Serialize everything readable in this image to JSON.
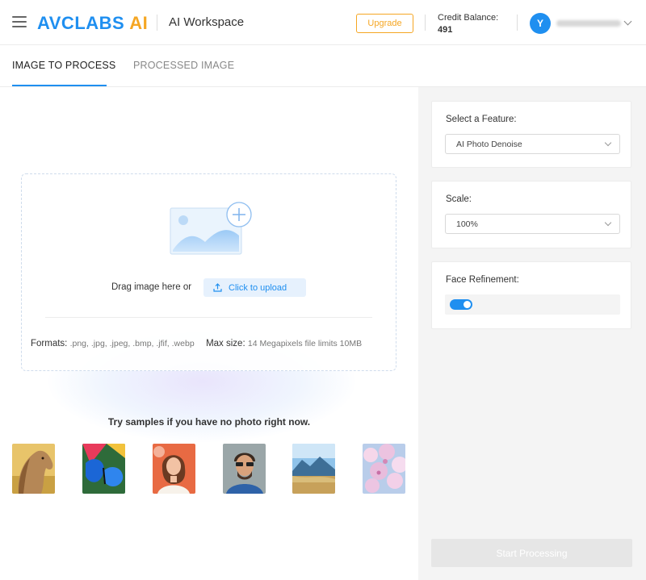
{
  "header": {
    "logo_brand": "AVCLABS",
    "logo_ai": "AI",
    "workspace_title": "AI Workspace",
    "upgrade_label": "Upgrade",
    "credit_label": "Credit Balance:",
    "credit_value": "491",
    "avatar_initial": "Y"
  },
  "tabs": [
    {
      "label": "IMAGE TO PROCESS",
      "active": true
    },
    {
      "label": "PROCESSED IMAGE",
      "active": false
    }
  ],
  "upload": {
    "drag_text": "Drag image here or",
    "button_label": "Click to upload",
    "formats_label": "Formats:",
    "formats_value": ".png, .jpg, .jpeg, .bmp, .jfif, .webp",
    "maxsize_label": "Max size:",
    "maxsize_value": "14 Megapixels file limits 10MB"
  },
  "samples": {
    "title": "Try samples if you have no photo right now.",
    "items": [
      "horse",
      "butterfly",
      "woman-portrait",
      "man-portrait",
      "mountain-landscape",
      "cherry-blossom"
    ]
  },
  "settings": {
    "feature_label": "Select a Feature:",
    "feature_value": "AI Photo Denoise",
    "scale_label": "Scale:",
    "scale_value": "100%",
    "face_label": "Face Refinement:",
    "face_enabled": true,
    "start_label": "Start Processing"
  },
  "colors": {
    "accent": "#1f8ff0",
    "orange": "#f5a623",
    "panel_bg": "#f4f4f4"
  }
}
